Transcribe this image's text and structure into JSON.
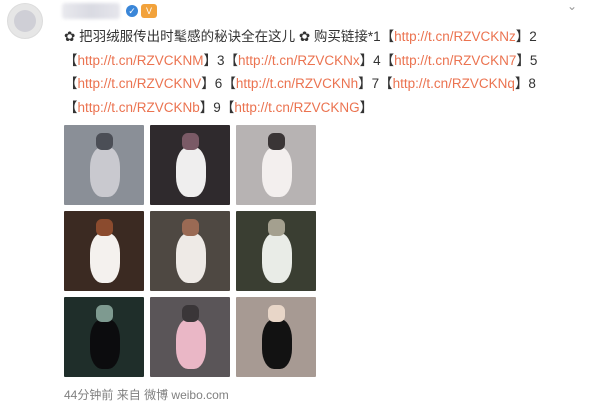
{
  "post": {
    "lead_icon": "✿",
    "text_part1": " 把羽绒服传出时髦感的秘诀全在这儿 ",
    "mid_icon": "✿",
    "text_part2": " 购买链接*",
    "links": [
      {
        "num": "1",
        "url": "http://t.cn/RZVCKNz"
      },
      {
        "num": "2",
        "url": "http://t.cn/RZVCKNM"
      },
      {
        "num": "3",
        "url": "http://t.cn/RZVCKNx"
      },
      {
        "num": "4",
        "url": "http://t.cn/RZVCKN7"
      },
      {
        "num": "5",
        "url": "http://t.cn/RZVCKNV"
      },
      {
        "num": "6",
        "url": "http://t.cn/RZVCKNh"
      },
      {
        "num": "7",
        "url": "http://t.cn/RZVCKNq"
      },
      {
        "num": "8",
        "url": "http://t.cn/RZVCKNb"
      },
      {
        "num": "9",
        "url": "http://t.cn/RZVCKNG"
      }
    ]
  },
  "header": {
    "verified_glyph": "✓",
    "badge_glyph": "V",
    "more_glyph": "⌄"
  },
  "photos": [
    {
      "name": "photo-1",
      "bg": "#8a8f97",
      "c1": "#c9c9cf",
      "c2": "#4b4e56"
    },
    {
      "name": "photo-2",
      "bg": "#2f2a2d",
      "c1": "#efeeee",
      "c2": "#7a5a66"
    },
    {
      "name": "photo-3",
      "bg": "#b7b3b3",
      "c1": "#f3efee",
      "c2": "#3a3536"
    },
    {
      "name": "photo-4",
      "bg": "#3b2a22",
      "c1": "#f4f1ee",
      "c2": "#8b4b2e"
    },
    {
      "name": "photo-5",
      "bg": "#4e4842",
      "c1": "#eeeae6",
      "c2": "#9a6a54"
    },
    {
      "name": "photo-6",
      "bg": "#3a3e32",
      "c1": "#e9ece7",
      "c2": "#a4a08f"
    },
    {
      "name": "photo-7",
      "bg": "#1f2e2a",
      "c1": "#0c0c0e",
      "c2": "#7e9a90"
    },
    {
      "name": "photo-8",
      "bg": "#5a5558",
      "c1": "#eab7c6",
      "c2": "#3a3638"
    },
    {
      "name": "photo-9",
      "bg": "#a79a93",
      "c1": "#121212",
      "c2": "#e8d6c8"
    }
  ],
  "footer": {
    "time": "44分钟前",
    "from_label": "来自",
    "source": "微博 weibo.com"
  },
  "colors": {
    "link": "#eb7350",
    "footer_text": "#808080"
  }
}
